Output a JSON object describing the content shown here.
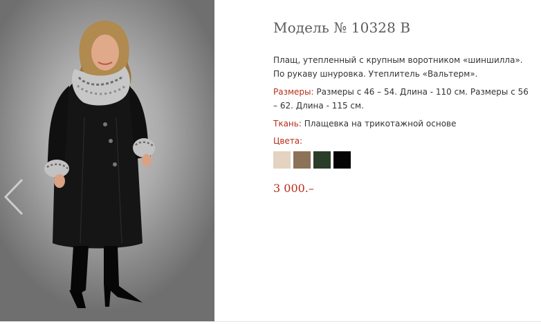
{
  "product": {
    "title": "Модель № 10328 В",
    "description": "Плащ, утепленный с крупным воротником «шиншилла». По рукаву шнуровка. Утеплитель «Вальтерм».",
    "sizes_label": "Размеры:",
    "sizes_value": "Размеры с 46 – 54. Длина - 110 см. Размеры с 56 – 62. Длина - 115 см.",
    "fabric_label": "Ткань:",
    "fabric_value": "Плащевка на трикотажной основе",
    "colors_label": "Цвета:",
    "colors": [
      "#e3d3c0",
      "#8c7256",
      "#2a3d29",
      "#050505"
    ],
    "price": "3 000.–"
  },
  "gallery": {
    "prev_icon": "chevron-left-icon"
  }
}
